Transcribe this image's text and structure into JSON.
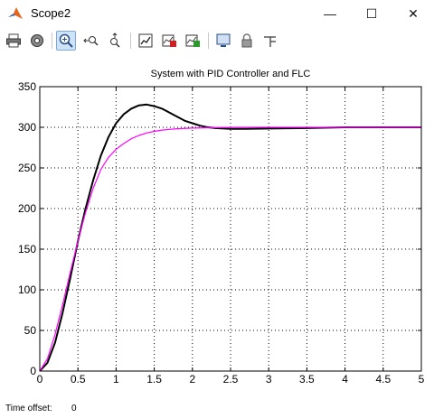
{
  "window": {
    "title": "Scope2",
    "minimize_glyph": "—",
    "maximize_glyph": "☐",
    "close_glyph": "✕"
  },
  "toolbar": {
    "icons": [
      "print-icon",
      "parameters-icon",
      "zoom-icon",
      "zoom-x-icon",
      "zoom-y-icon",
      "autoscale-icon",
      "save-axes-icon",
      "restore-axes-icon",
      "floating-scope-icon",
      "lock-icon",
      "signal-selection-icon"
    ]
  },
  "colors": {
    "series_pid": "#000000",
    "series_flc": "#ff00ff",
    "grid": "#000000",
    "app_icon": "#e8641b"
  },
  "status": {
    "time_offset_label": "Time offset:",
    "time_offset_value": "0"
  },
  "chart_data": {
    "type": "line",
    "title": "System with PID Controller and FLC",
    "xlabel": "",
    "ylabel": "",
    "xlim": [
      0,
      5
    ],
    "ylim": [
      0,
      350
    ],
    "xticks": [
      "0",
      "0.5",
      "1",
      "1.5",
      "2",
      "2.5",
      "3",
      "3.5",
      "4",
      "4.5",
      "5"
    ],
    "yticks": [
      "0",
      "50",
      "100",
      "150",
      "200",
      "250",
      "300",
      "350"
    ],
    "grid": true,
    "series": [
      {
        "color": "#000000",
        "points": [
          [
            0,
            0
          ],
          [
            0.1,
            10
          ],
          [
            0.2,
            35
          ],
          [
            0.3,
            72
          ],
          [
            0.4,
            115
          ],
          [
            0.5,
            160
          ],
          [
            0.6,
            200
          ],
          [
            0.7,
            235
          ],
          [
            0.8,
            265
          ],
          [
            0.9,
            288
          ],
          [
            1.0,
            305
          ],
          [
            1.1,
            316
          ],
          [
            1.2,
            323
          ],
          [
            1.3,
            327
          ],
          [
            1.4,
            328
          ],
          [
            1.5,
            326
          ],
          [
            1.6,
            323
          ],
          [
            1.7,
            318
          ],
          [
            1.8,
            313
          ],
          [
            1.9,
            308
          ],
          [
            2.0,
            305
          ],
          [
            2.1,
            302
          ],
          [
            2.2,
            300
          ],
          [
            2.3,
            299
          ],
          [
            2.5,
            298
          ],
          [
            2.7,
            298
          ],
          [
            3.0,
            298.5
          ],
          [
            3.5,
            299
          ],
          [
            4.0,
            300
          ],
          [
            5.0,
            300
          ]
        ]
      },
      {
        "color": "#ff00ff",
        "points": [
          [
            0,
            0
          ],
          [
            0.1,
            15
          ],
          [
            0.2,
            45
          ],
          [
            0.3,
            82
          ],
          [
            0.4,
            122
          ],
          [
            0.5,
            160
          ],
          [
            0.6,
            195
          ],
          [
            0.7,
            225
          ],
          [
            0.8,
            248
          ],
          [
            0.9,
            263
          ],
          [
            1.0,
            273
          ],
          [
            1.1,
            280
          ],
          [
            1.2,
            286
          ],
          [
            1.3,
            290
          ],
          [
            1.4,
            293
          ],
          [
            1.5,
            295
          ],
          [
            1.6,
            296.5
          ],
          [
            1.7,
            297.5
          ],
          [
            1.8,
            298.2
          ],
          [
            2.0,
            299
          ],
          [
            2.3,
            299.5
          ],
          [
            2.6,
            300
          ],
          [
            3.0,
            300
          ],
          [
            5.0,
            300
          ]
        ]
      }
    ]
  }
}
